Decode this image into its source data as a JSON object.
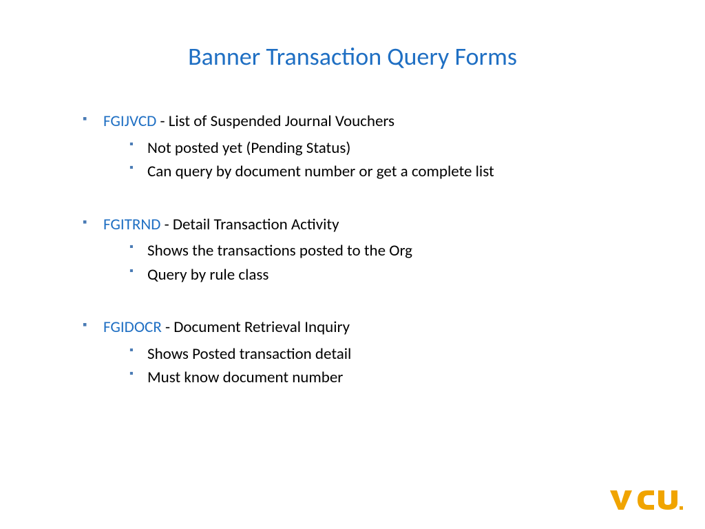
{
  "title": "Banner Transaction Query Forms",
  "items": [
    {
      "code": "FGIJVCD",
      "desc": " - List of Suspended Journal Vouchers",
      "subs": [
        "Not posted yet (Pending Status)",
        "Can query by document number or get a complete list"
      ]
    },
    {
      "code": "FGITRND",
      "desc": " - Detail Transaction Activity",
      "subs": [
        "Shows the transactions posted to the Org",
        "Query by rule class"
      ]
    },
    {
      "code": "FGIDOCR",
      "desc": " - Document Retrieval Inquiry",
      "subs": [
        "Shows Posted transaction detail",
        "Must know document number"
      ]
    }
  ],
  "logo_text": "VCU"
}
